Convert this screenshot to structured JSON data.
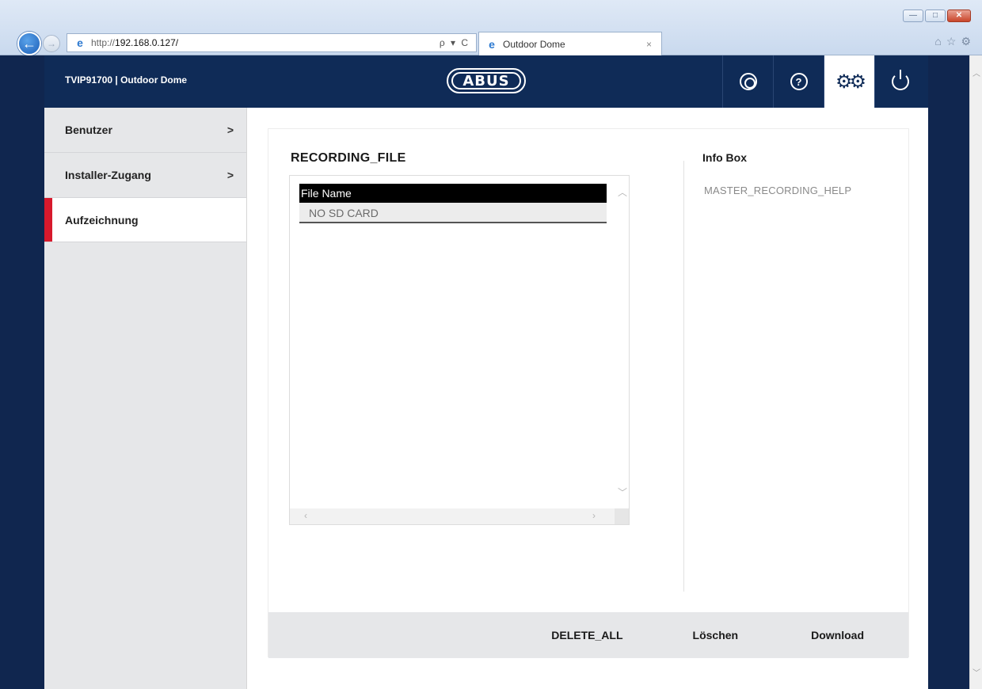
{
  "browser": {
    "url_prefix": "http://",
    "url_host": "192.168.0.127/",
    "tab_title": "Outdoor Dome",
    "tab_close": "×",
    "address_tools": "ρ ▾ C"
  },
  "header": {
    "device_title": "TVIP91700 | Outdoor Dome",
    "brand": "ABUS"
  },
  "sidebar": {
    "items": [
      {
        "label": "Benutzer",
        "chevron": ">"
      },
      {
        "label": "Installer-Zugang",
        "chevron": ">"
      },
      {
        "label": "Aufzeichnung"
      }
    ]
  },
  "main": {
    "section_title": "RECORDING_FILE",
    "table": {
      "header": "File Name",
      "rows": [
        "NO SD CARD"
      ]
    },
    "info": {
      "title": "Info Box",
      "text": "MASTER_RECORDING_HELP"
    },
    "actions": {
      "delete_all": "DELETE_ALL",
      "delete": "Löschen",
      "download": "Download"
    }
  },
  "colors": {
    "header_bg": "#0f2b57",
    "side_band": "#10264f",
    "sidebar_bg": "#e6e7e9",
    "active_marker": "#d7192c"
  }
}
